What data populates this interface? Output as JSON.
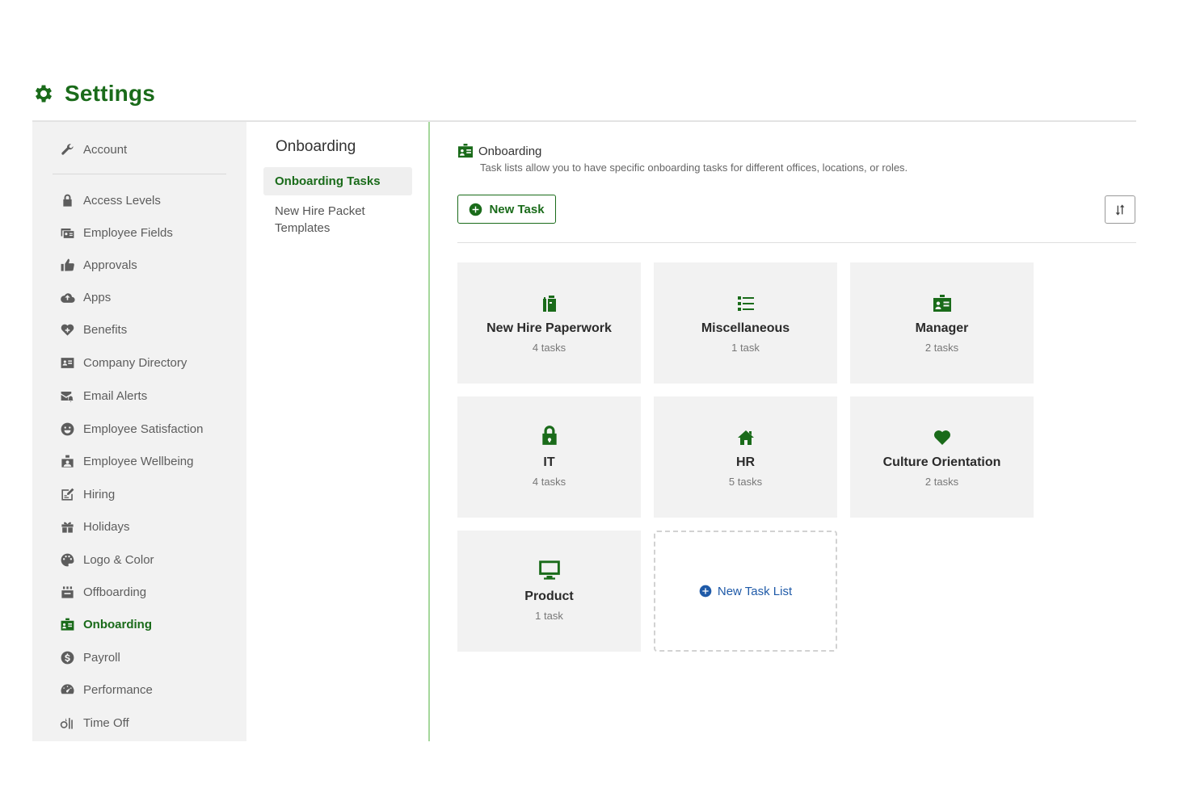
{
  "header": {
    "title": "Settings",
    "icon": "gear-icon"
  },
  "colors": {
    "brand_green": "#1a6b1a",
    "link_blue": "#1f5aa8",
    "muted_gray": "#5d5d5d",
    "panel_bg": "#f2f2f2",
    "accent_rule": "#a5d79b"
  },
  "sidebar": {
    "items": [
      {
        "label": "Account",
        "icon": "wrench-icon"
      },
      {
        "label": "Access Levels",
        "icon": "lock-icon"
      },
      {
        "label": "Employee Fields",
        "icon": "id-cards-icon"
      },
      {
        "label": "Approvals",
        "icon": "thumbs-up-icon"
      },
      {
        "label": "Apps",
        "icon": "cloud-upload-icon"
      },
      {
        "label": "Benefits",
        "icon": "heart-plus-icon"
      },
      {
        "label": "Company Directory",
        "icon": "address-card-icon"
      },
      {
        "label": "Email Alerts",
        "icon": "mail-bell-icon"
      },
      {
        "label": "Employee Satisfaction",
        "icon": "smile-icon"
      },
      {
        "label": "Employee Wellbeing",
        "icon": "wellbeing-icon"
      },
      {
        "label": "Hiring",
        "icon": "edit-doc-icon"
      },
      {
        "label": "Holidays",
        "icon": "gift-icon"
      },
      {
        "label": "Logo & Color",
        "icon": "palette-icon"
      },
      {
        "label": "Offboarding",
        "icon": "box-out-icon"
      },
      {
        "label": "Onboarding",
        "icon": "id-badge-icon",
        "active": true
      },
      {
        "label": "Payroll",
        "icon": "dollar-circle-icon"
      },
      {
        "label": "Performance",
        "icon": "gauge-icon"
      },
      {
        "label": "Time Off",
        "icon": "time-off-icon"
      }
    ]
  },
  "subnav": {
    "title": "Onboarding",
    "items": [
      {
        "label": "Onboarding Tasks",
        "active": true
      },
      {
        "label": "New Hire Packet Templates"
      }
    ]
  },
  "main": {
    "title": "Onboarding",
    "title_icon": "id-badge-icon",
    "description": "Task lists allow you to have specific onboarding tasks for different offices, locations, or roles.",
    "new_task_label": "New Task",
    "sort_icon": "sort-arrows-icon",
    "task_lists": [
      {
        "name": "New Hire Paperwork",
        "count": "4 tasks",
        "icon": "clipboard-icon"
      },
      {
        "name": "Miscellaneous",
        "count": "1 task",
        "icon": "list-icon"
      },
      {
        "name": "Manager",
        "count": "2 tasks",
        "icon": "id-card-icon"
      },
      {
        "name": "IT",
        "count": "4 tasks",
        "icon": "lock-icon"
      },
      {
        "name": "HR",
        "count": "5 tasks",
        "icon": "home-icon"
      },
      {
        "name": "Culture Orientation",
        "count": "2 tasks",
        "icon": "heart-icon"
      },
      {
        "name": "Product",
        "count": "1 task",
        "icon": "monitor-icon"
      }
    ],
    "new_task_list_label": "New Task List"
  }
}
